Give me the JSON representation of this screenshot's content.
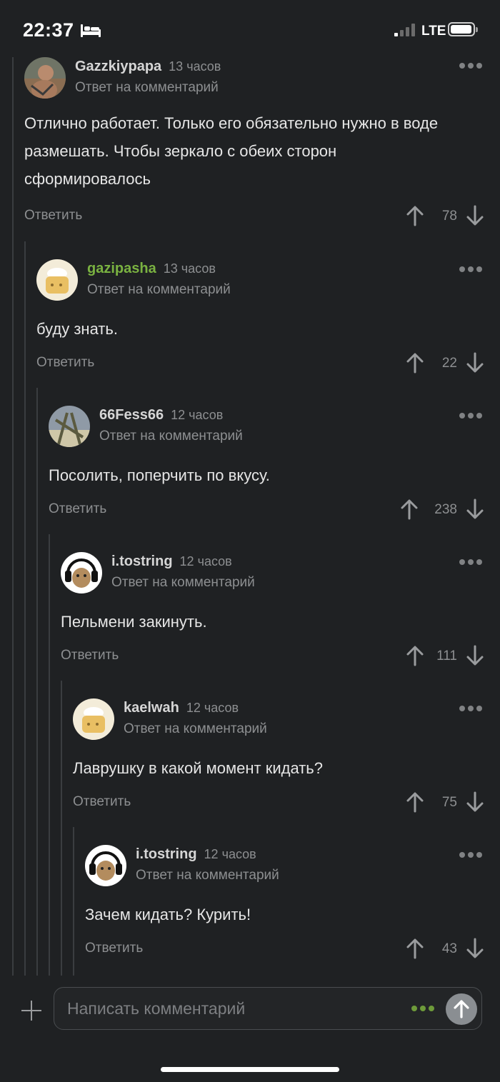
{
  "status_bar": {
    "time": "22:37",
    "network": "LTE",
    "icons": [
      "bed-icon",
      "signal-icon",
      "battery-icon"
    ]
  },
  "comments": [
    {
      "username": "Gazzkiypapa",
      "time": "13 часов",
      "reply_label": "Ответ на комментарий",
      "text": "Отлично работает. Только его обязательно нужно в воде размешать. Чтобы зеркало с обеих сторон сформировалось",
      "reply_button": "Ответить",
      "score": "78"
    },
    {
      "username": "gazipasha",
      "time": "13 часов",
      "reply_label": "Ответ на комментарий",
      "text": "буду знать.",
      "reply_button": "Ответить",
      "score": "22"
    },
    {
      "username": "66Fess66",
      "time": "12 часов",
      "reply_label": "Ответ на комментарий",
      "text": "Посолить, поперчить по вкусу.",
      "reply_button": "Ответить",
      "score": "238"
    },
    {
      "username": "i.tostring",
      "time": "12 часов",
      "reply_label": "Ответ на комментарий",
      "text": "Пельмени закинуть.",
      "reply_button": "Ответить",
      "score": "111"
    },
    {
      "username": "kaelwah",
      "time": "12 часов",
      "reply_label": "Ответ на комментарий",
      "text": "Лаврушку в какой момент кидать?",
      "reply_button": "Ответить",
      "score": "75"
    },
    {
      "username": "i.tostring",
      "time": "12 часов",
      "reply_label": "Ответ на комментарий",
      "text": "Зачем кидать? Курить!",
      "reply_button": "Ответить",
      "score": "43"
    }
  ],
  "composer": {
    "placeholder": "Написать комментарий"
  },
  "colors": {
    "background": "#1f2123",
    "accent_green": "#7ab241",
    "muted": "#8d8f91"
  }
}
